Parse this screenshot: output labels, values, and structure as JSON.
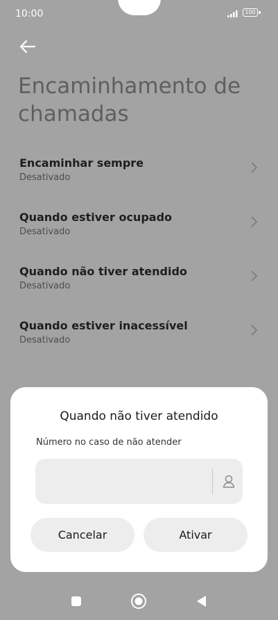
{
  "status_bar": {
    "time": "10:00",
    "battery_level": "100",
    "signal_icon": "signal-icon",
    "battery_icon": "battery-icon"
  },
  "header": {
    "back_icon": "arrow-left-icon",
    "title": "Encaminhamento de chamadas"
  },
  "menu": {
    "items": [
      {
        "label": "Encaminhar sempre",
        "status": "Desativado"
      },
      {
        "label": "Quando estiver ocupado",
        "status": "Desativado"
      },
      {
        "label": "Quando não tiver atendido",
        "status": "Desativado"
      },
      {
        "label": "Quando estiver inacessível",
        "status": "Desativado"
      }
    ],
    "chevron_icon": "chevron-right-icon"
  },
  "dialog": {
    "title": "Quando não tiver atendido",
    "field_label": "Número no caso de não atender",
    "field_value": "",
    "contact_icon": "person-icon",
    "cancel_label": "Cancelar",
    "activate_label": "Ativar"
  },
  "nav_bar": {
    "recent_icon": "square-icon",
    "home_icon": "circle-icon",
    "back_icon": "triangle-back-icon"
  },
  "colors": {
    "overlay_background": "#a3a3a3",
    "dialog_background": "#ffffff",
    "button_background": "#ededed"
  }
}
